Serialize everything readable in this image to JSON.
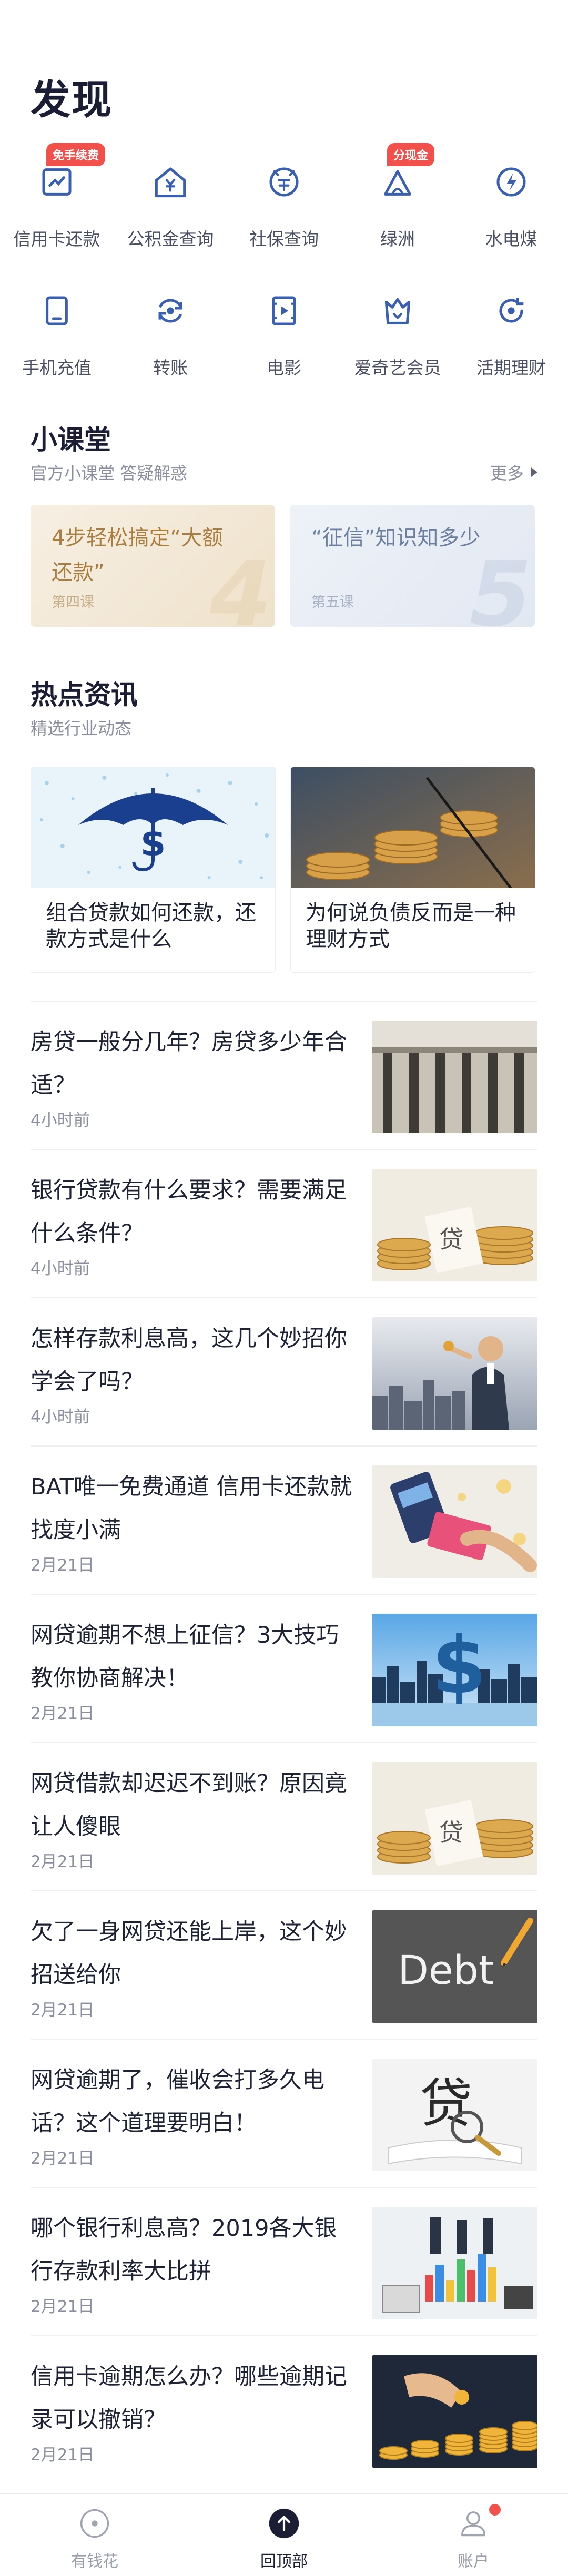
{
  "page": {
    "title": "发现"
  },
  "services": [
    {
      "label": "信用卡还款",
      "icon": "credit-card-repay-icon",
      "badge": "免手续费"
    },
    {
      "label": "公积金查询",
      "icon": "housing-fund-icon",
      "badge": ""
    },
    {
      "label": "社保查询",
      "icon": "social-security-icon",
      "badge": ""
    },
    {
      "label": "绿洲",
      "icon": "oasis-icon",
      "badge": "分现金"
    },
    {
      "label": "水电煤",
      "icon": "utilities-icon",
      "badge": ""
    },
    {
      "label": "手机充值",
      "icon": "phone-recharge-icon",
      "badge": ""
    },
    {
      "label": "转账",
      "icon": "transfer-icon",
      "badge": ""
    },
    {
      "label": "电影",
      "icon": "movie-icon",
      "badge": ""
    },
    {
      "label": "爱奇艺会员",
      "icon": "iqiyi-vip-icon",
      "badge": ""
    },
    {
      "label": "活期理财",
      "icon": "current-finance-icon",
      "badge": ""
    }
  ],
  "classroom": {
    "title": "小课堂",
    "subtitle": "官方小课堂 答疑解惑",
    "more": "更多",
    "lessons": [
      {
        "title": "4步轻松搞定“大额还款”",
        "lesson_no": "第四课",
        "big_no": "4"
      },
      {
        "title": "“征信”知识知多少",
        "lesson_no": "第五课",
        "big_no": "5"
      }
    ]
  },
  "hot_news": {
    "title": "热点资讯",
    "subtitle": "精选行业动态",
    "featured": [
      {
        "title": "组合贷款如何还款，还款方式是什么"
      },
      {
        "title": "为何说负债反而是一种理财方式"
      }
    ],
    "list": [
      {
        "title": "房贷一般分几年？房贷多少年合适？",
        "time": "4小时前"
      },
      {
        "title": "银行贷款有什么要求？需要满足什么条件？",
        "time": "4小时前"
      },
      {
        "title": "怎样存款利息高，这几个妙招你学会了吗？",
        "time": "4小时前"
      },
      {
        "title": "BAT唯一免费通道 信用卡还款就找度小满",
        "time": "2月21日"
      },
      {
        "title": "网贷逾期不想上征信？3大技巧教你协商解决！",
        "time": "2月21日"
      },
      {
        "title": "网贷借款却迟迟不到账？原因竟让人傻眼",
        "time": "2月21日"
      },
      {
        "title": "欠了一身网贷还能上岸，这个妙招送给你",
        "time": "2月21日"
      },
      {
        "title": "网贷逾期了，催收会打多久电话？这个道理要明白！",
        "time": "2月21日"
      },
      {
        "title": "哪个银行利息高？2019各大银行存款利率大比拼",
        "time": "2月21日"
      },
      {
        "title": "信用卡逾期怎么办？哪些逾期记录可以撤销？",
        "time": "2月21日"
      }
    ],
    "thumb_texts": {
      "debt": "Debt",
      "dai": "贷"
    }
  },
  "tabbar": [
    {
      "label": "有钱花",
      "icon": "youqianhua-icon",
      "active": false
    },
    {
      "label": "回顶部",
      "icon": "back-to-top-icon",
      "active": true
    },
    {
      "label": "账户",
      "icon": "account-icon",
      "active": false
    }
  ],
  "colors": {
    "icon_blue": "#3a5fb0",
    "badge_red": "#f2514b",
    "title": "#1a1d33"
  }
}
